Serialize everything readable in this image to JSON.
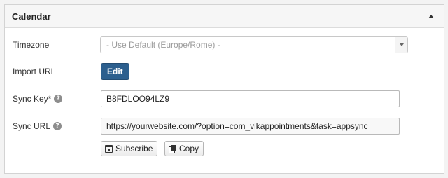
{
  "panel": {
    "title": "Calendar",
    "collapse_icon": "caret-up-icon"
  },
  "fields": {
    "timezone": {
      "label": "Timezone",
      "selected": "- Use Default (Europe/Rome) -"
    },
    "import_url": {
      "label": "Import URL",
      "button": "Edit"
    },
    "sync_key": {
      "label": "Sync Key*",
      "help": "?",
      "value": "B8FDLOO94LZ9"
    },
    "sync_url": {
      "label": "Sync URL",
      "help": "?",
      "value": "https://yourwebsite.com/?option=com_vikappointments&task=appsync",
      "subscribe_label": "Subscribe",
      "copy_label": "Copy"
    }
  },
  "colors": {
    "primary_button": "#2c5f8e"
  }
}
